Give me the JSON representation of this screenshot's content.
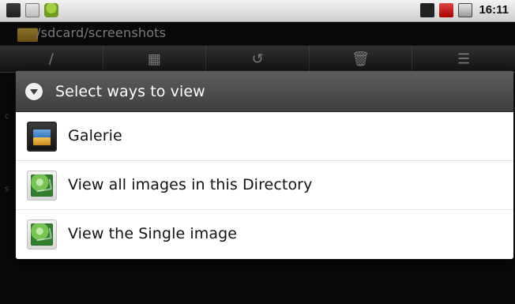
{
  "status_bar": {
    "left_icons": [
      "usb-icon",
      "message-icon",
      "android-icon"
    ],
    "right_icons": [
      "bluetooth-icon",
      "no-signal-icon",
      "battery-icon"
    ],
    "time": "16:11"
  },
  "path_bar": {
    "folder_icon": "folder-icon",
    "path": "/sdcard/screenshots"
  },
  "toolbar": {
    "buttons": [
      {
        "icon": "slash-icon",
        "glyph": "/"
      },
      {
        "icon": "folder-icon",
        "glyph": "▦"
      },
      {
        "icon": "undo-icon",
        "glyph": "↺"
      },
      {
        "icon": "trash-icon",
        "glyph": "🗑"
      },
      {
        "icon": "list-icon",
        "glyph": "☰"
      }
    ]
  },
  "background_marks": {
    "left_mark_1": "c",
    "left_mark_2": "s"
  },
  "dialog": {
    "title": "Select ways to view",
    "header_icon": "chevron-down-circle-icon",
    "options": [
      {
        "label": "Galerie",
        "icon": "gallery-icon"
      },
      {
        "label": "View all images in this Directory",
        "icon": "image-icon"
      },
      {
        "label": "View the Single image",
        "icon": "image-icon"
      }
    ]
  }
}
